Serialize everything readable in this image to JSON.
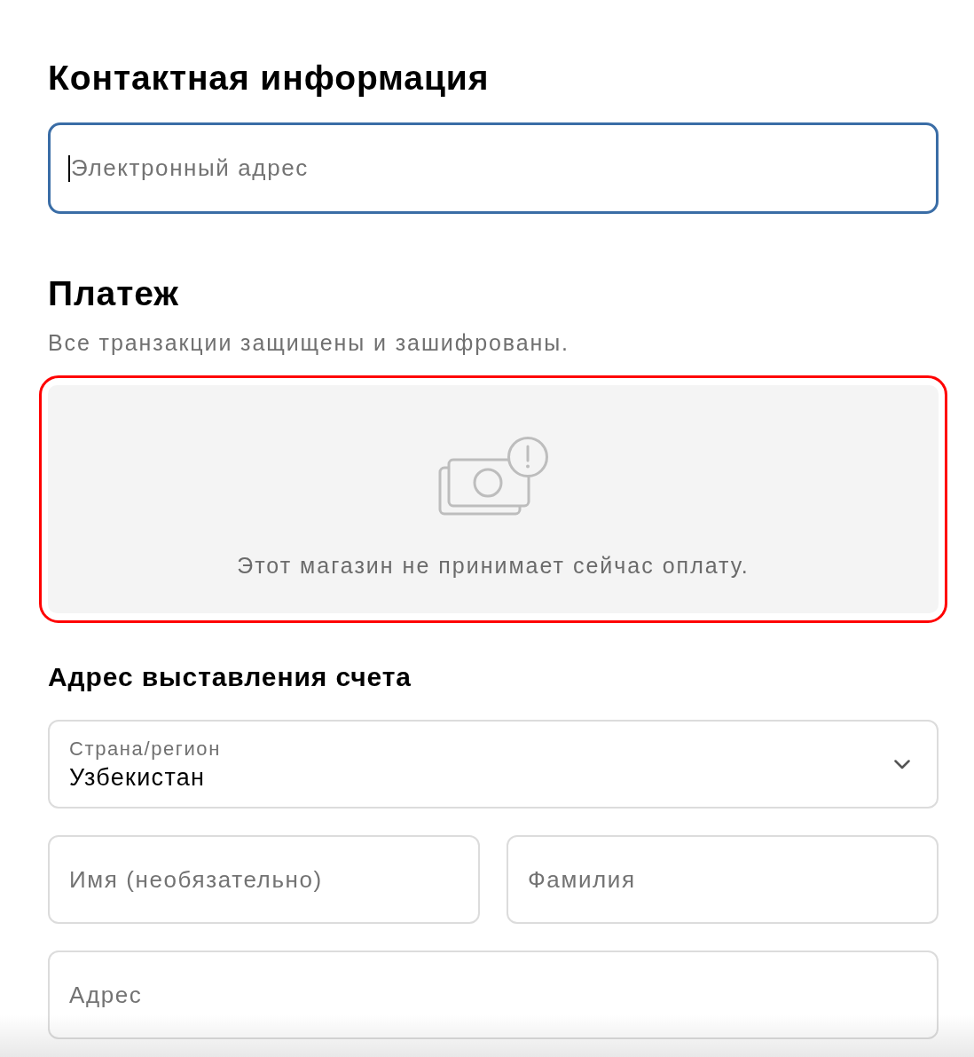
{
  "contact": {
    "title": "Контактная информация",
    "email": {
      "placeholder": "Электронный адрес",
      "focused": true
    }
  },
  "payment": {
    "title": "Платеж",
    "subtitle": "Все транзакции защищены и зашифрованы.",
    "notice": {
      "message": "Этот магазин не принимает сейчас оплату.",
      "highlighted": true
    }
  },
  "billing": {
    "title": "Адрес выставления счета",
    "rows": [
      {
        "fields": [
          {
            "kind": "select",
            "label": "Страна/регион",
            "value": "Узбекистан"
          }
        ]
      },
      {
        "fields": [
          {
            "kind": "input",
            "placeholder": "Имя (необязательно)"
          },
          {
            "kind": "input",
            "placeholder": "Фамилия"
          }
        ]
      },
      {
        "fields": [
          {
            "kind": "input",
            "placeholder": "Адрес"
          }
        ]
      }
    ]
  }
}
